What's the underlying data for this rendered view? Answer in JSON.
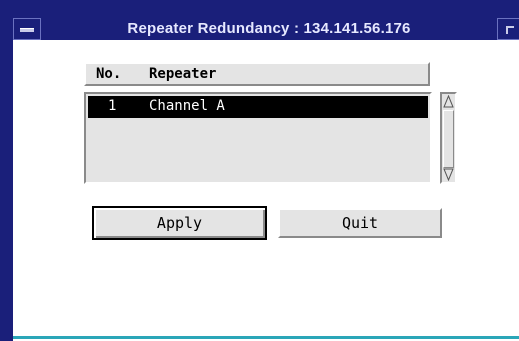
{
  "window": {
    "title": "Repeater Redundancy : 134.141.56.176"
  },
  "table": {
    "headers": {
      "no": "No.",
      "repeater": "Repeater"
    },
    "rows": [
      {
        "no": "1",
        "name": "Channel A",
        "selected": true
      }
    ]
  },
  "scrollbar": {
    "up_arrow": "▲",
    "down_arrow": "▼"
  },
  "buttons": {
    "apply": "Apply",
    "quit": "Quit"
  },
  "colors": {
    "title_bar": "#1a1f7a",
    "accent_line": "#2aa6b8",
    "panel": "#e4e4e4",
    "selection": "#000000"
  }
}
